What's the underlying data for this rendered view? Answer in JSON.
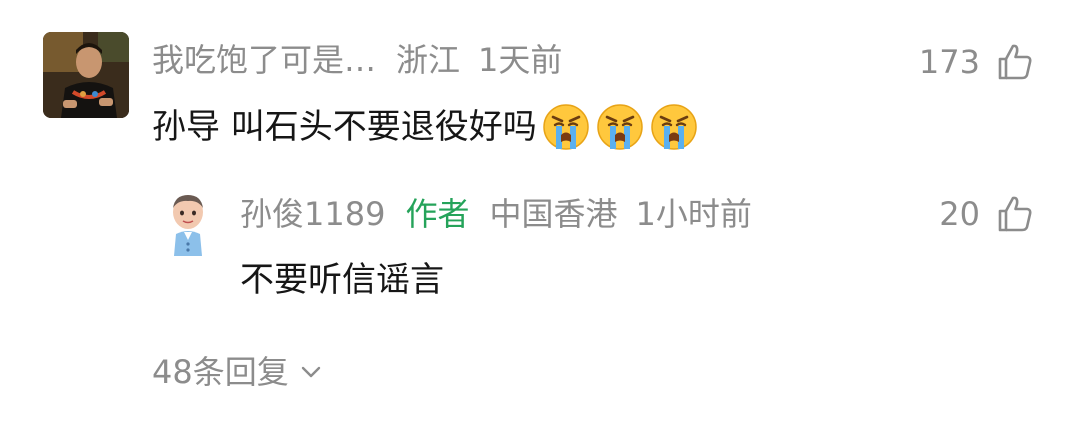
{
  "comment": {
    "username": "我吃饱了可是…",
    "region": "浙江",
    "time": "1天前",
    "text": "孙导 叫石头不要退役好吗",
    "emoji_count": 3,
    "likes": "173"
  },
  "reply": {
    "username": "孙俊1189",
    "author_tag": "作者",
    "region": "中国香港",
    "time": "1小时前",
    "text": "不要听信谣言",
    "likes": "20"
  },
  "view_replies": {
    "label": "48条回复"
  },
  "colors": {
    "meta_gray": "#8c8c8c",
    "author_green": "#25a35a",
    "text_dark": "#161616"
  }
}
